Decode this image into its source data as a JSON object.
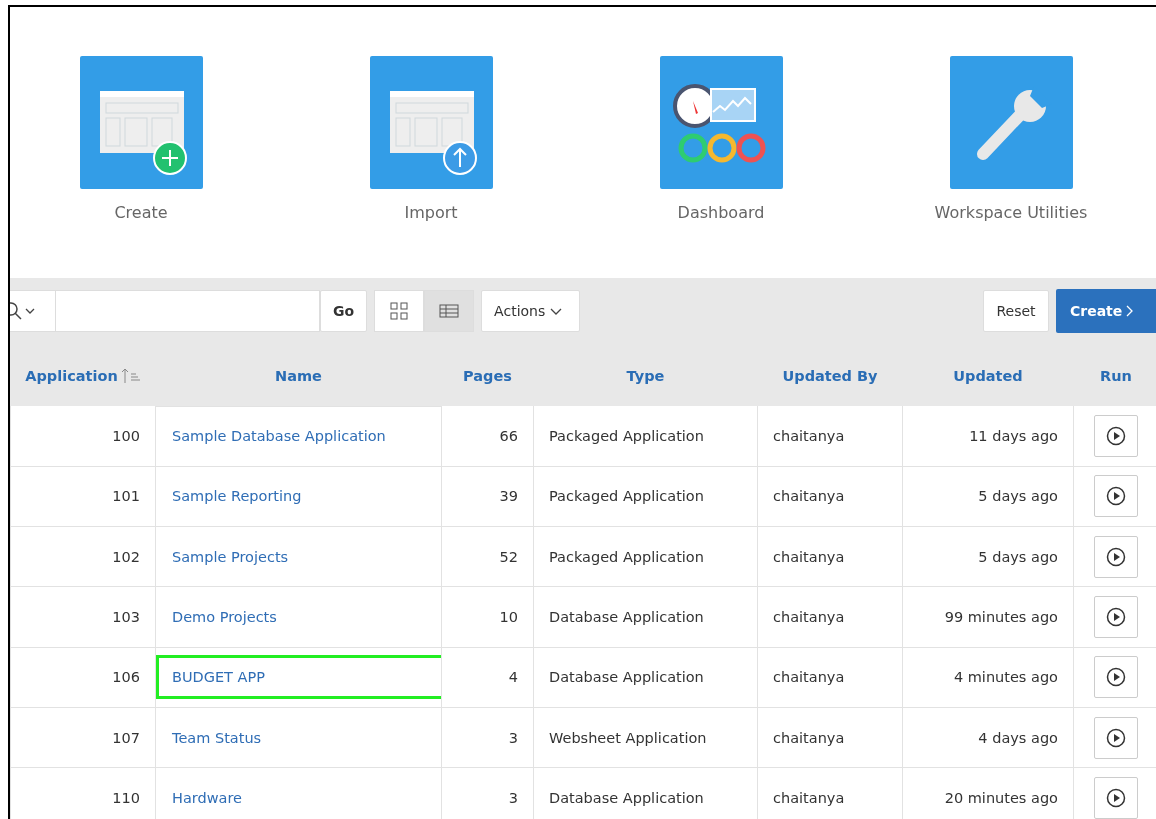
{
  "tiles": [
    {
      "kind": "create",
      "label": "Create"
    },
    {
      "kind": "import",
      "label": "Import"
    },
    {
      "kind": "dashboard",
      "label": "Dashboard"
    },
    {
      "kind": "utilities",
      "label": "Workspace Utilities"
    }
  ],
  "toolbar": {
    "go": "Go",
    "views": [
      {
        "kind": "icons",
        "selected": false
      },
      {
        "kind": "report",
        "selected": true
      }
    ],
    "actions": "Actions",
    "reset": "Reset",
    "create": "Create"
  },
  "table": {
    "columns": [
      "Application",
      "Name",
      "Pages",
      "Type",
      "Updated By",
      "Updated",
      "Run"
    ],
    "rows": [
      {
        "application": "100",
        "name": "Sample Database Application",
        "pages": "66",
        "type": "Packaged Application",
        "updated_by": "chaitanya",
        "updated": "11 days ago",
        "highlighted": false
      },
      {
        "application": "101",
        "name": "Sample Reporting",
        "pages": "39",
        "type": "Packaged Application",
        "updated_by": "chaitanya",
        "updated": "5 days ago",
        "highlighted": false
      },
      {
        "application": "102",
        "name": "Sample Projects",
        "pages": "52",
        "type": "Packaged Application",
        "updated_by": "chaitanya",
        "updated": "5 days ago",
        "highlighted": false
      },
      {
        "application": "103",
        "name": "Demo Projects",
        "pages": "10",
        "type": "Database Application",
        "updated_by": "chaitanya",
        "updated": "99 minutes ago",
        "highlighted": false
      },
      {
        "application": "106",
        "name": "BUDGET APP",
        "pages": "4",
        "type": "Database Application",
        "updated_by": "chaitanya",
        "updated": "4 minutes ago",
        "highlighted": true
      },
      {
        "application": "107",
        "name": "Team Status",
        "pages": "3",
        "type": "Websheet Application",
        "updated_by": "chaitanya",
        "updated": "4 days ago",
        "highlighted": false
      },
      {
        "application": "110",
        "name": "Hardware",
        "pages": "3",
        "type": "Database Application",
        "updated_by": "chaitanya",
        "updated": "20 minutes ago",
        "highlighted": false
      }
    ]
  }
}
